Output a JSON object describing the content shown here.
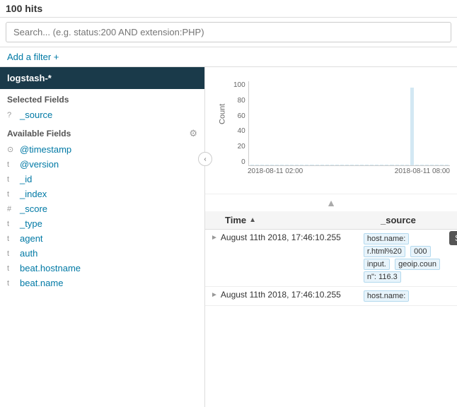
{
  "header": {
    "hits": "100",
    "hits_label": "100 hits"
  },
  "search": {
    "placeholder": "Search... (e.g. status:200 AND extension:PHP)",
    "value": ""
  },
  "filter": {
    "add_label": "Add a filter +"
  },
  "sidebar": {
    "index_pattern": "logstash-*",
    "selected_fields_title": "Selected Fields",
    "selected_fields": [
      {
        "type": "?",
        "name": "_source"
      }
    ],
    "available_fields_title": "Available Fields",
    "available_fields": [
      {
        "type": "⊙",
        "name": "@timestamp"
      },
      {
        "type": "t",
        "name": "@version"
      },
      {
        "type": "t",
        "name": "_id"
      },
      {
        "type": "t",
        "name": "_index"
      },
      {
        "type": "#",
        "name": "_score"
      },
      {
        "type": "t",
        "name": "_type"
      },
      {
        "type": "t",
        "name": "agent"
      },
      {
        "type": "t",
        "name": "auth"
      },
      {
        "type": "t",
        "name": "beat.hostname"
      },
      {
        "type": "t",
        "name": "beat.name"
      }
    ]
  },
  "chart": {
    "y_ticks": [
      "100",
      "80",
      "60",
      "40",
      "20",
      "0"
    ],
    "x_labels": [
      "2018-08-11 02:00",
      "2018-08-11 08:00"
    ],
    "y_label": "Count",
    "bars": [
      0,
      0,
      0,
      0,
      0,
      0,
      0,
      0,
      0,
      0,
      0,
      0,
      0,
      0,
      0,
      0,
      0,
      0,
      0,
      0,
      0,
      0,
      0,
      0,
      0,
      0,
      0,
      0,
      0,
      0,
      0,
      0,
      100,
      0,
      0,
      0,
      0,
      0,
      0,
      0
    ]
  },
  "table": {
    "col_time": "Time",
    "col_source": "_source",
    "sort_tooltip": "Sort by time",
    "rows": [
      {
        "time": "August 11th 2018, 17:46:10.255",
        "source_tags": [
          "host.name:",
          "r.html%20",
          "000",
          "input.",
          "geoip.coun",
          "n\": 116.3"
        ]
      },
      {
        "time": "August 11th 2018, 17:46:10.255",
        "source_tags": [
          "host.name:"
        ]
      }
    ]
  }
}
